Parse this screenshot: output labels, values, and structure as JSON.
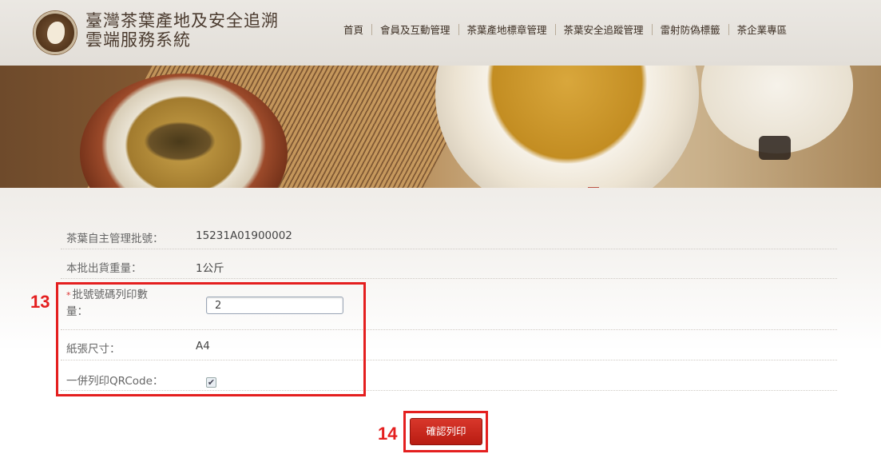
{
  "header": {
    "title_line1": "臺灣茶葉產地及安全追溯",
    "title_line2": "雲端服務系統",
    "nav": [
      "首頁",
      "會員及互動管理",
      "茶葉產地標章管理",
      "茶葉安全追蹤管理",
      "雷射防偽標籤",
      "茶企業專區"
    ]
  },
  "form": {
    "batch_label": "茶葉自主管理批號：",
    "batch_value": "15231A01900002",
    "quantity_label": "本批出貨重量：",
    "quantity_value": "1公斤",
    "required_mark": "*",
    "print_count_label_line1": "批號號碼列印數",
    "print_count_label_line2": "量：",
    "print_count_value": "2",
    "paper_label": "紙張尺寸：",
    "paper_value": "A4",
    "qrcode_label": "一併列印QRCode：",
    "qrcode_checked": true
  },
  "annotations": {
    "step13": "13",
    "step14": "14",
    "color": "#e41f1f"
  },
  "actions": {
    "confirm_print": "確認列印"
  }
}
